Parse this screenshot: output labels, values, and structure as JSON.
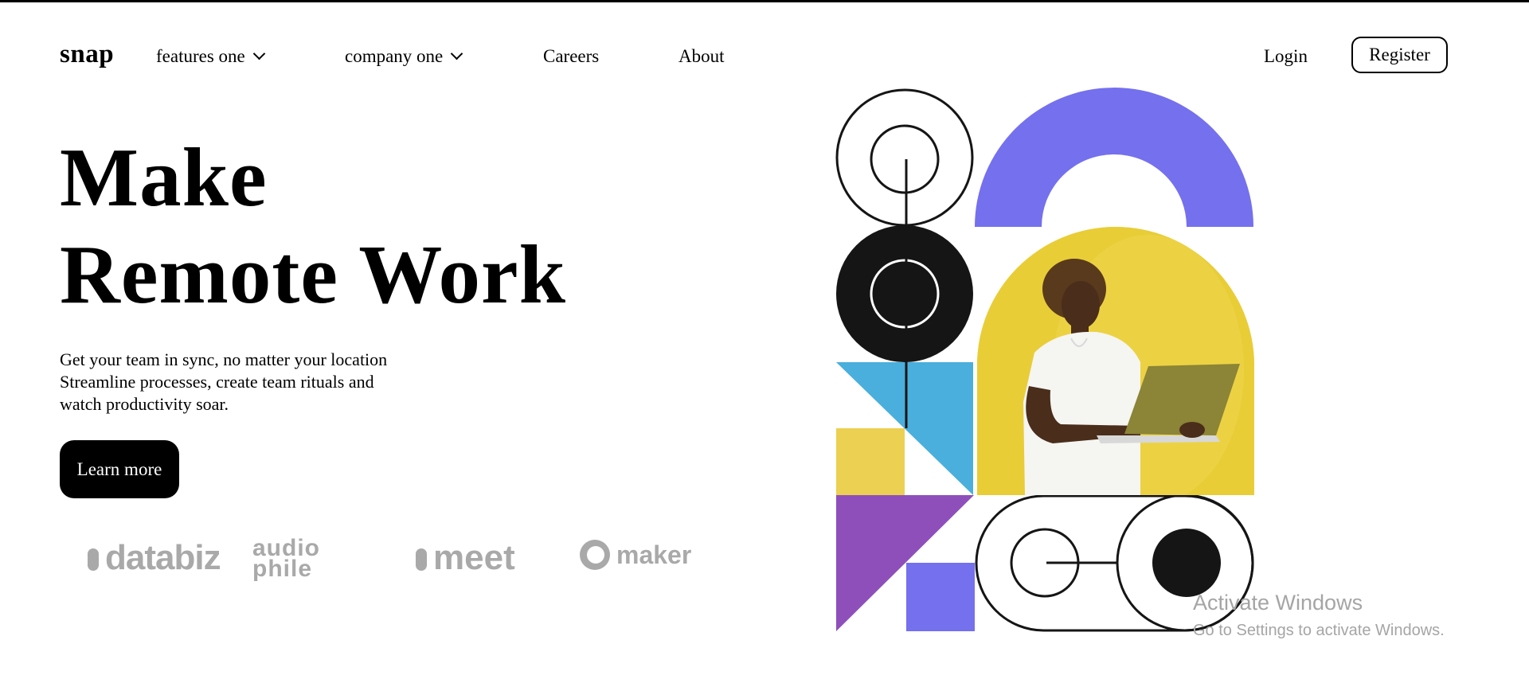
{
  "nav": {
    "logo": "snap",
    "items": [
      {
        "label": "features one",
        "dropdown": true
      },
      {
        "label": "company one",
        "dropdown": true
      },
      {
        "label": "Careers",
        "dropdown": false
      },
      {
        "label": "About",
        "dropdown": false
      }
    ],
    "login": "Login",
    "register": "Register"
  },
  "hero": {
    "headline_line1": "Make",
    "headline_line2": "Remote Work",
    "subtitle_line1": "Get your team in sync, no matter your location",
    "subtitle_line2": "Streamline processes, create team rituals and",
    "subtitle_line3": "watch productivity soar.",
    "cta": "Learn more"
  },
  "clients": {
    "databiz": "databiz",
    "audiophile_line1": "audio",
    "audiophile_line2": "phile",
    "meet": "meet",
    "maker": "maker"
  },
  "colors": {
    "accent_purple": "#7470ee",
    "yellow": "#ecd051",
    "cyan": "#4aafdc",
    "violet": "#8e4fbb",
    "ink": "#151515",
    "logo_gray": "#a9a9a9"
  },
  "watermark": {
    "title": "Activate Windows",
    "subtitle": "Go to Settings to activate Windows."
  }
}
